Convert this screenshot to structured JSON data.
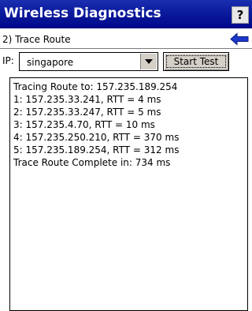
{
  "title_bar": {
    "title": "Wireless Diagnostics",
    "help_label": "?",
    "background": "#0b1a9c"
  },
  "section": {
    "label": "2) Trace Route",
    "back_icon": "left-arrow-icon"
  },
  "controls": {
    "ip_label": "IP:",
    "ip_value": "singapore",
    "dropdown_icon": "chevron-down-icon",
    "start_label": "Start Test"
  },
  "output": {
    "lines": [
      "Tracing Route to: 157.235.189.254",
      "1: 157.235.33.241, RTT = 4 ms",
      "2: 157.235.33.247, RTT = 5 ms",
      "3: 157.235.4.70, RTT = 10 ms",
      "4: 157.235.250.210, RTT = 370 ms",
      "5: 157.235.189.254, RTT = 312 ms",
      "Trace Route Complete in: 734 ms"
    ]
  }
}
